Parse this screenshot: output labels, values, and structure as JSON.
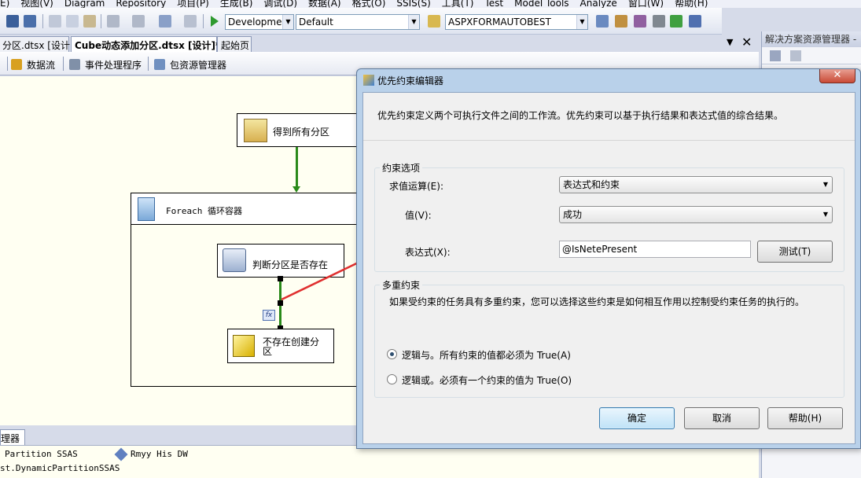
{
  "menu": {
    "items": [
      "E)",
      "视图(V)",
      "Diagram",
      "Repository",
      "项目(P)",
      "生成(B)",
      "调试(D)",
      "数据(A)",
      "格式(O)",
      "SSIS(S)",
      "工具(T)",
      "Test",
      "Model Tools",
      "Analyze",
      "窗口(W)",
      "帮助(H)"
    ]
  },
  "toolbar": {
    "config_combo": "Developmer",
    "platform_combo": "Default",
    "project_combo": "ASPXFORMAUTOBEST"
  },
  "doc_tabs": {
    "tab1": "分区.dtsx [设计]",
    "tab2": "Cube动态添加分区.dtsx [设计]*",
    "tab3": "起始页",
    "dropdown_glyph": "▼",
    "close_glyph": "✕"
  },
  "designer_tabs": {
    "data_flow": "数据流",
    "event_handlers": "事件处理程序",
    "package_explorer": "包资源管理器"
  },
  "canvas": {
    "task_get_partitions": "得到所有分区",
    "foreach_container": "Foreach 循环容器",
    "task_check_exists": "判断分区是否存在",
    "task_create": "不存在创建分区",
    "fx_badge": "fx"
  },
  "bottom": {
    "tab_label": "理器",
    "line1_a": "Partition SSAS",
    "line1_b": "Rmyy His DW",
    "line2": "st.DynamicPartitionSSAS"
  },
  "solution_explorer": {
    "title": "解决方案资源管理器 -"
  },
  "dialog": {
    "title": "优先约束编辑器",
    "close_glyph": "✕",
    "description": "优先约束定义两个可执行文件之间的工作流。优先约束可以基于执行结果和表达式值的综合结果。",
    "constraint_group": "约束选项",
    "eval_op_label": "求值运算(E):",
    "eval_op_value": "表达式和约束",
    "value_label": "值(V):",
    "value_value": "成功",
    "expression_label": "表达式(X):",
    "expression_value": "@IsNetePresent",
    "test_button": "测试(T)",
    "multi_group": "多重约束",
    "multi_desc": "如果受约束的任务具有多重约束，您可以选择这些约束是如何相互作用以控制受约束任务的执行的。",
    "radio_and": "逻辑与。所有约束的值都必须为 True(A)",
    "radio_or": "逻辑或。必须有一个约束的值为 True(O)",
    "ok_button": "确定",
    "cancel_button": "取消",
    "help_button": "帮助(H)"
  },
  "colors": {
    "arrow_red": "#e03030",
    "flow_green": "#2a8a1a"
  }
}
